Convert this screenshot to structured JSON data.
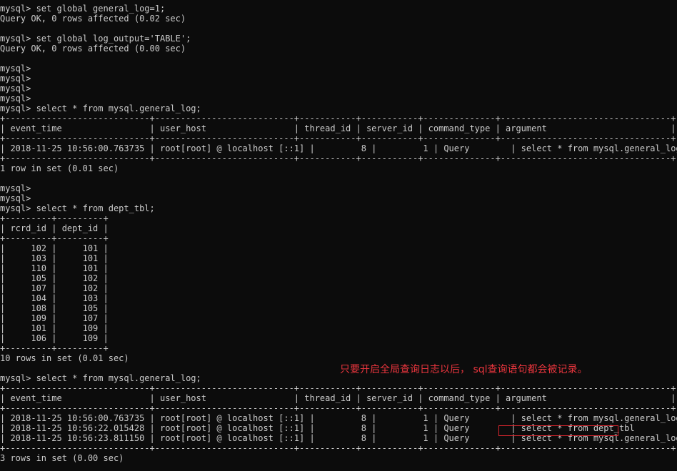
{
  "console": {
    "lines": [
      "mysql> set global general_log=1;",
      "Query OK, 0 rows affected (0.02 sec)",
      "",
      "mysql> set global log_output='TABLE';",
      "Query OK, 0 rows affected (0.00 sec)",
      "",
      "mysql>",
      "mysql>",
      "mysql>",
      "mysql>",
      "mysql> select * from mysql.general_log;",
      "+----------------------------+---------------------------+-----------+-----------+--------------+---------------------------------+",
      "| event_time                 | user_host                 | thread_id | server_id | command_type | argument                        |",
      "+----------------------------+---------------------------+-----------+-----------+--------------+---------------------------------+",
      "| 2018-11-25 10:56:00.763735 | root[root] @ localhost [::1] |         8 |         1 | Query        | select * from mysql.general_log |",
      "+----------------------------+---------------------------+-----------+-----------+--------------+---------------------------------+",
      "1 row in set (0.01 sec)",
      "",
      "mysql>",
      "mysql>",
      "mysql> select * from dept_tbl;",
      "+---------+---------+",
      "| rcrd_id | dept_id |",
      "+---------+---------+",
      "|     102 |     101 |",
      "|     103 |     101 |",
      "|     110 |     101 |",
      "|     105 |     102 |",
      "|     107 |     102 |",
      "|     104 |     103 |",
      "|     108 |     105 |",
      "|     109 |     107 |",
      "|     101 |     109 |",
      "|     106 |     109 |",
      "+---------+---------+",
      "10 rows in set (0.01 sec)",
      "",
      "mysql> select * from mysql.general_log;",
      "+----------------------------+---------------------------+-----------+-----------+--------------+---------------------------------+",
      "| event_time                 | user_host                 | thread_id | server_id | command_type | argument                        |",
      "+----------------------------+---------------------------+-----------+-----------+--------------+---------------------------------+",
      "| 2018-11-25 10:56:00.763735 | root[root] @ localhost [::1] |         8 |         1 | Query        | select * from mysql.general_log |",
      "| 2018-11-25 10:56:22.015428 | root[root] @ localhost [::1] |         8 |         1 | Query        | select * from dept_tbl          |",
      "| 2018-11-25 10:56:23.811150 | root[root] @ localhost [::1] |         8 |         1 | Query        | select * from mysql.general_log |",
      "+----------------------------+---------------------------+-----------+-----------+--------------+---------------------------------+",
      "3 rows in set (0.00 sec)"
    ]
  },
  "annotation": {
    "text": "只要开启全局查询日志以后， sql查询语句都会被记录。",
    "color": "#e8353d"
  },
  "colors": {
    "background": "#0c0c0c",
    "foreground": "#cccccc",
    "highlight_border": "#d8262e"
  }
}
